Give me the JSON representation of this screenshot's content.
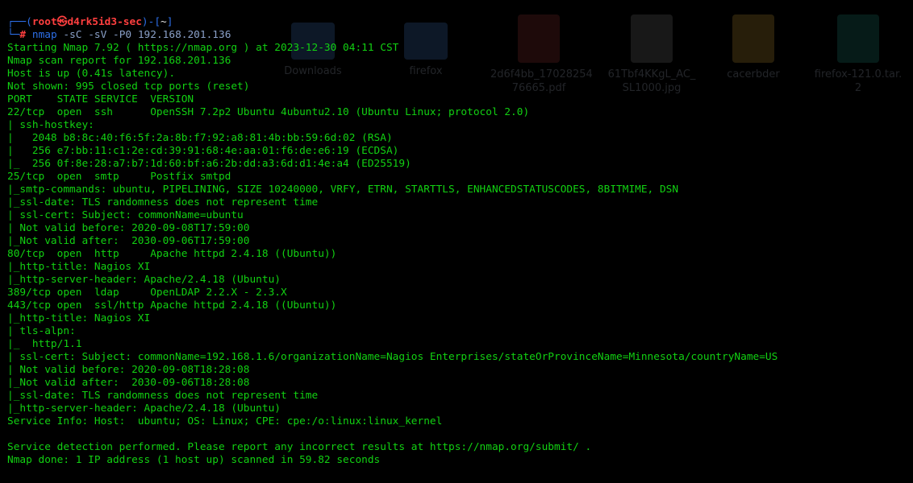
{
  "desktop_icons": [
    {
      "label": "Downloads",
      "icon": "folder-icon"
    },
    {
      "label": "firefox",
      "icon": "folder-icon"
    },
    {
      "label": "2d6f4bb_17028254 76665.pdf",
      "icon": "pdf-icon"
    },
    {
      "label": "61Tbf4KKgL_AC_ SL1000.jpg",
      "icon": "image-icon"
    },
    {
      "label": "cacerbder",
      "icon": "document-icon"
    },
    {
      "label": "firefox-121.0.tar. 2",
      "icon": "archive-icon"
    }
  ],
  "prompt": {
    "open": "┌──(",
    "user": "root",
    "skull": "㉿",
    "host": "d4rk5id3-sec",
    "close": ")-[",
    "dir": "~",
    "end": "]",
    "arrow": "└─",
    "hash": "#",
    "command": "nmap",
    "args": " -sC -sV -P0 192.168.201.136"
  },
  "output_lines": [
    "Starting Nmap 7.92 ( https://nmap.org ) at 2023-12-30 04:11 CST",
    "Nmap scan report for 192.168.201.136",
    "Host is up (0.41s latency).",
    "Not shown: 995 closed tcp ports (reset)",
    "PORT    STATE SERVICE  VERSION",
    "22/tcp  open  ssh      OpenSSH 7.2p2 Ubuntu 4ubuntu2.10 (Ubuntu Linux; protocol 2.0)",
    "| ssh-hostkey: ",
    "|   2048 b8:8c:40:f6:5f:2a:8b:f7:92:a8:81:4b:bb:59:6d:02 (RSA)",
    "|   256 e7:bb:11:c1:2e:cd:39:91:68:4e:aa:01:f6:de:e6:19 (ECDSA)",
    "|_  256 0f:8e:28:a7:b7:1d:60:bf:a6:2b:dd:a3:6d:d1:4e:a4 (ED25519)",
    "25/tcp  open  smtp     Postfix smtpd",
    "|_smtp-commands: ubuntu, PIPELINING, SIZE 10240000, VRFY, ETRN, STARTTLS, ENHANCEDSTATUSCODES, 8BITMIME, DSN",
    "|_ssl-date: TLS randomness does not represent time",
    "| ssl-cert: Subject: commonName=ubuntu",
    "| Not valid before: 2020-09-08T17:59:00",
    "|_Not valid after:  2030-09-06T17:59:00",
    "80/tcp  open  http     Apache httpd 2.4.18 ((Ubuntu))",
    "|_http-title: Nagios XI",
    "|_http-server-header: Apache/2.4.18 (Ubuntu)",
    "389/tcp open  ldap     OpenLDAP 2.2.X - 2.3.X",
    "443/tcp open  ssl/http Apache httpd 2.4.18 ((Ubuntu))",
    "|_http-title: Nagios XI",
    "| tls-alpn: ",
    "|_  http/1.1",
    "| ssl-cert: Subject: commonName=192.168.1.6/organizationName=Nagios Enterprises/stateOrProvinceName=Minnesota/countryName=US",
    "| Not valid before: 2020-09-08T18:28:08",
    "|_Not valid after:  2030-09-06T18:28:08",
    "|_ssl-date: TLS randomness does not represent time",
    "|_http-server-header: Apache/2.4.18 (Ubuntu)",
    "Service Info: Host:  ubuntu; OS: Linux; CPE: cpe:/o:linux:linux_kernel",
    "",
    "Service detection performed. Please report any incorrect results at https://nmap.org/submit/ .",
    "Nmap done: 1 IP address (1 host up) scanned in 59.82 seconds"
  ],
  "colors": {
    "background": "#000000",
    "output_text": "#12d112",
    "prompt_frame": "#2d6fe8",
    "prompt_user_host": "#ff3f3f"
  }
}
